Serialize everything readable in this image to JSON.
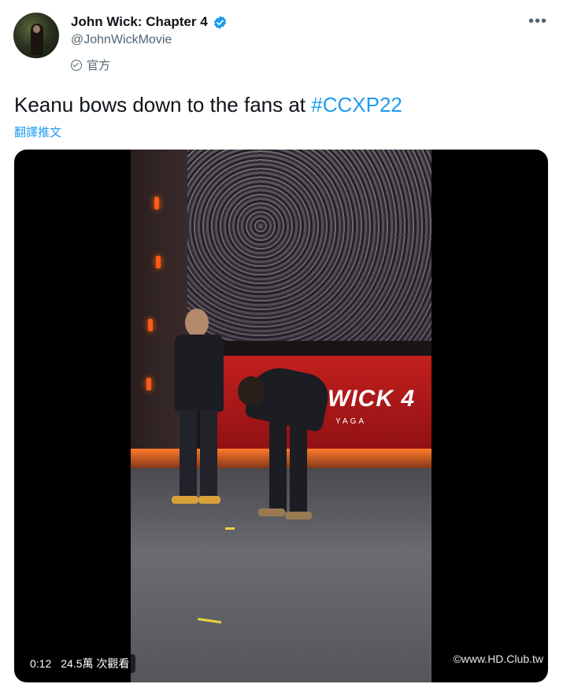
{
  "author": {
    "name": "John Wick: Chapter 4",
    "handle": "@JohnWickMovie",
    "label": "官方"
  },
  "menu_icon": "more-horizontal-icon",
  "tweet": {
    "text": "Keanu bows down to the fans at ",
    "hashtag": "#CCXP22",
    "translate_label": "翻譯推文"
  },
  "video": {
    "elapsed": "0:12",
    "views": "24.5萬 次觀看",
    "banner_text": "WICK 4",
    "banner_sub": "YAGA",
    "watermark": "©www.HD.Club.tw"
  },
  "colors": {
    "accent": "#1d9bf0",
    "text": "#0f1419",
    "secondary": "#536471"
  }
}
